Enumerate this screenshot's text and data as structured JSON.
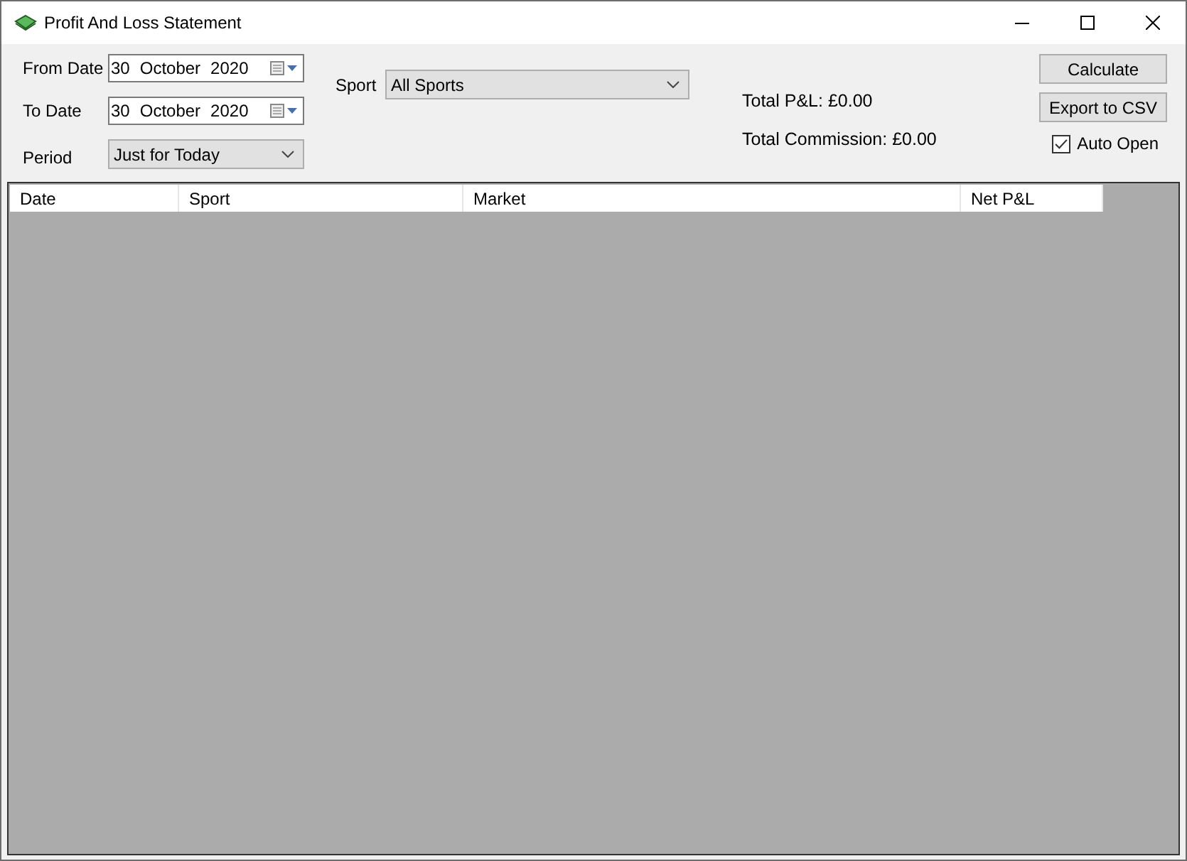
{
  "window": {
    "title": "Profit And Loss Statement"
  },
  "from_date": {
    "label": "From Date",
    "day": "30",
    "month": "October",
    "year": "2020"
  },
  "to_date": {
    "label": "To Date",
    "day": "30",
    "month": "October",
    "year": "2020"
  },
  "period": {
    "label": "Period",
    "value": "Just for Today"
  },
  "sport": {
    "label": "Sport",
    "value": "All Sports"
  },
  "totals": [
    "Total P&L: £0.00",
    "Total Commission: £0.00"
  ],
  "buttons": [
    "Calculate",
    "Export to CSV"
  ],
  "auto_open": {
    "label": "Auto Open",
    "checked": true
  },
  "table": {
    "columns": [
      "Date",
      "Sport",
      "Market",
      "Net P&L"
    ]
  }
}
